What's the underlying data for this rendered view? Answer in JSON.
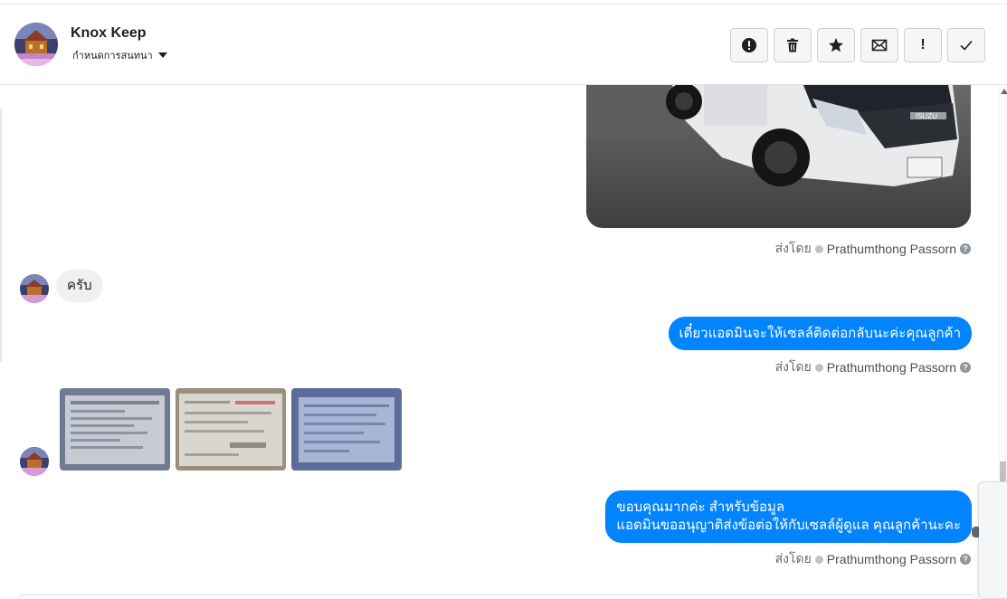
{
  "header": {
    "contact_name": "Knox Keep",
    "assign_label": "กำหนดการสนทนา",
    "actions": [
      {
        "name": "spam-button",
        "icon": "alert-circle-icon"
      },
      {
        "name": "delete-button",
        "icon": "trash-icon"
      },
      {
        "name": "star-button",
        "icon": "star-icon"
      },
      {
        "name": "mark-unread-button",
        "icon": "envelope-icon"
      },
      {
        "name": "follow-up-button",
        "icon": "exclamation-icon",
        "text": "!"
      },
      {
        "name": "mark-done-button",
        "icon": "checkmark-icon"
      }
    ]
  },
  "messages": {
    "car_image": {
      "from": "page",
      "type": "image",
      "description_icon": "photo"
    },
    "sent_by_1": {
      "prefix": "ส่งโดย",
      "agent": "Prathumthong Passorn",
      "help": "?"
    },
    "incoming_1": {
      "from": "customer",
      "text": "ครับ"
    },
    "outgoing_1": {
      "from": "page",
      "text": "เดี๋ยวแอดมินจะให้เซลล์ติดต่อกลับนะค่ะคุณลูกค้า"
    },
    "sent_by_2": {
      "prefix": "ส่งโดย",
      "agent": "Prathumthong Passorn",
      "help": "?"
    },
    "incoming_images": {
      "from": "customer",
      "count": 3
    },
    "outgoing_2": {
      "from": "page",
      "line1": "ขอบคุณมากค่ะ สำหรับข้อมูล",
      "line2": "แอดมินขออนุญาติส่งข้อต่อให้กับเซลล์ผู้ดูแล คุณลูกค้านะคะ"
    },
    "sent_by_3": {
      "prefix": "ส่งโดย",
      "agent": "Prathumthong Passorn",
      "help": "?"
    }
  },
  "colors": {
    "outgoing_bubble": "#0084ff",
    "incoming_bubble": "#f1f0f0",
    "meta_text": "#606770"
  }
}
